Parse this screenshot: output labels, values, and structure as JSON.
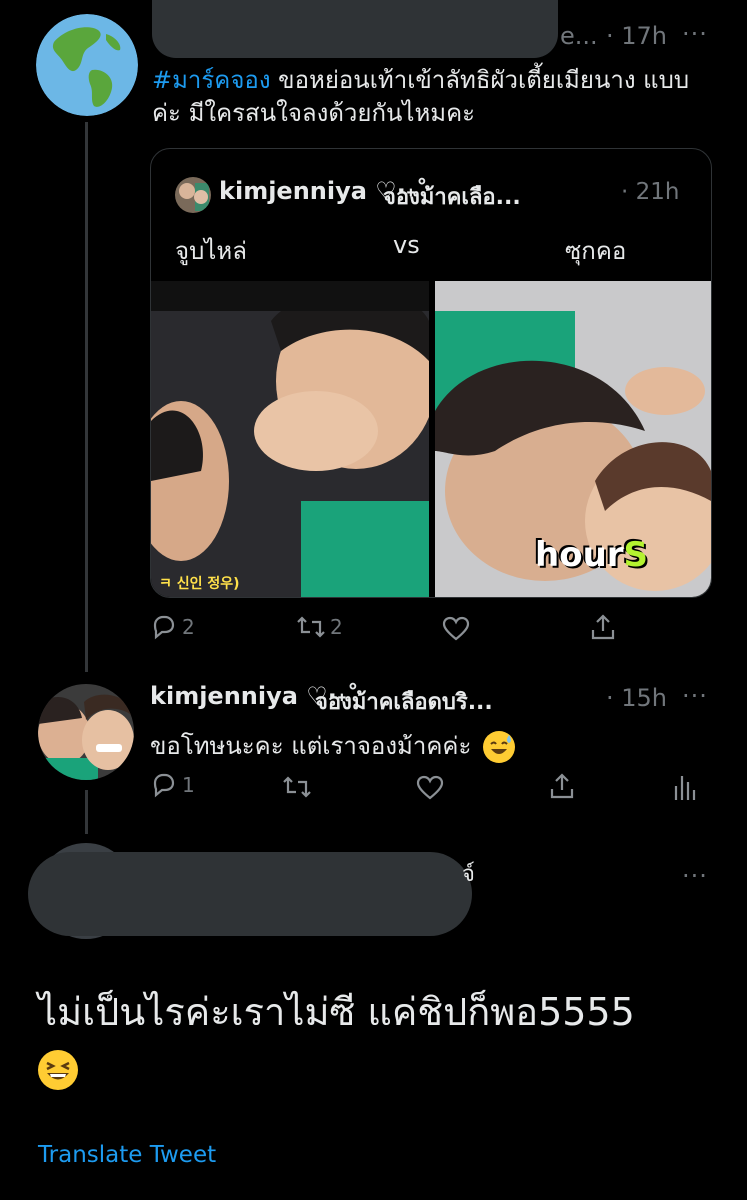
{
  "tweet": {
    "name_tail": "e...",
    "time": "· 17h",
    "more": "···",
    "hashtag": "#มาร์คจอง",
    "text": " ขอหย่อนเท้าเข้าลัทธิผัวเตี้ยเมียนาง แบบค่ะ มีใครสนใจลงด้วยกันไหมคะ",
    "quote": {
      "name": "kimjenniya ♡·˖˚",
      "handle": "จองม้าคเลือ...",
      "time": "· 21h",
      "left_caption": "จูบไหล่",
      "vs": "vs",
      "right_caption": "ซุกคอ",
      "left_overlay": "ㅋ 신인 정우)",
      "right_overlay_main": "hour",
      "right_overlay_end": "S"
    },
    "actions": {
      "reply_count": "2",
      "retweet_count": "2"
    }
  },
  "reply1": {
    "name": "kimjenniya ♡·˖˚",
    "handle": "จองม้าคเลือดบริ...",
    "time": "· 15h",
    "more": "···",
    "text": "ขอโทษนะคะ แต่เราจองม้าคค่ะ",
    "actions": {
      "reply_count": "1"
    }
  },
  "reply2": {
    "name_fragment": "จ์",
    "more": "···",
    "text": "ไม่เป็นไรค่ะเราไม่ซี แค่ชิปก็พอ5555",
    "translate": "Translate Tweet"
  },
  "colors": {
    "background": "#000000",
    "text": "#e7e9ea",
    "muted": "#71767b",
    "link": "#1d9bf0",
    "border": "#2f3336"
  },
  "icons": [
    "reply-icon",
    "retweet-icon",
    "like-icon",
    "share-icon",
    "analytics-icon",
    "more-icon"
  ]
}
